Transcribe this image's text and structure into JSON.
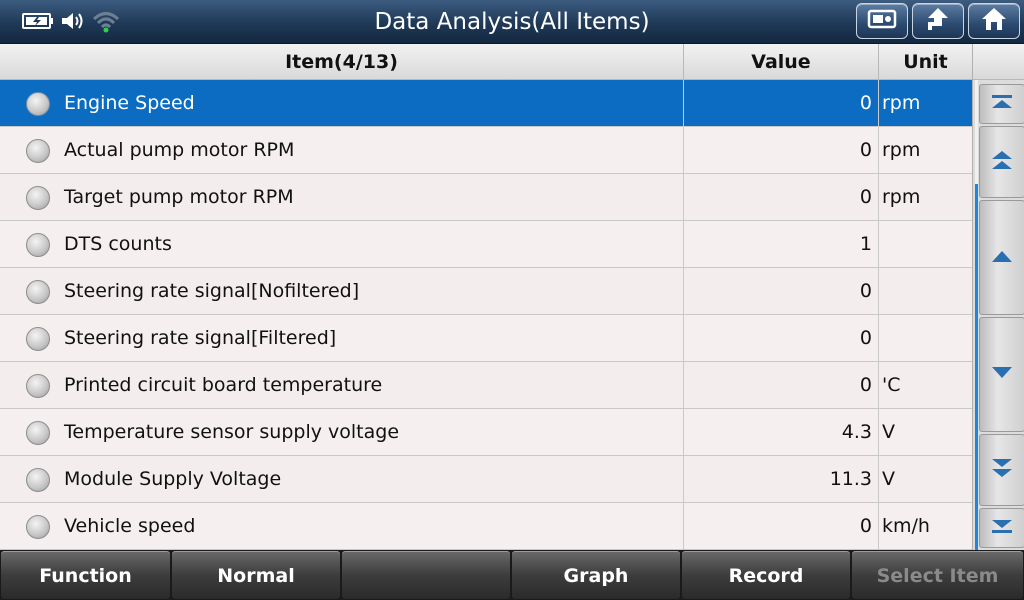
{
  "header": {
    "title": "Data Analysis(All Items)",
    "buttons": [
      "screen-capture-icon",
      "back-arrow-icon",
      "home-icon"
    ]
  },
  "table": {
    "columns": {
      "item": "Item(4/13)",
      "value": "Value",
      "unit": "Unit"
    },
    "rows": [
      {
        "item": "Engine Speed",
        "value": "0",
        "unit": "rpm",
        "selected": true
      },
      {
        "item": "Actual pump motor RPM",
        "value": "0",
        "unit": "rpm"
      },
      {
        "item": "Target pump motor RPM",
        "value": "0",
        "unit": "rpm"
      },
      {
        "item": "DTS counts",
        "value": "1",
        "unit": ""
      },
      {
        "item": "Steering rate signal[Nofiltered]",
        "value": "0",
        "unit": ""
      },
      {
        "item": "Steering rate signal[Filtered]",
        "value": "0",
        "unit": ""
      },
      {
        "item": "Printed circuit board temperature",
        "value": "0",
        "unit": "'C"
      },
      {
        "item": "Temperature sensor supply voltage",
        "value": "4.3",
        "unit": "V"
      },
      {
        "item": "Module Supply Voltage",
        "value": "11.3",
        "unit": "V"
      },
      {
        "item": "Vehicle speed",
        "value": "0",
        "unit": "km/h"
      }
    ]
  },
  "footer": {
    "buttons": [
      "Function",
      "Normal",
      "",
      "Graph",
      "Record",
      "Select Item"
    ]
  },
  "colors": {
    "selected_row": "#0b6cc1",
    "title_bar": "#1f3957"
  }
}
